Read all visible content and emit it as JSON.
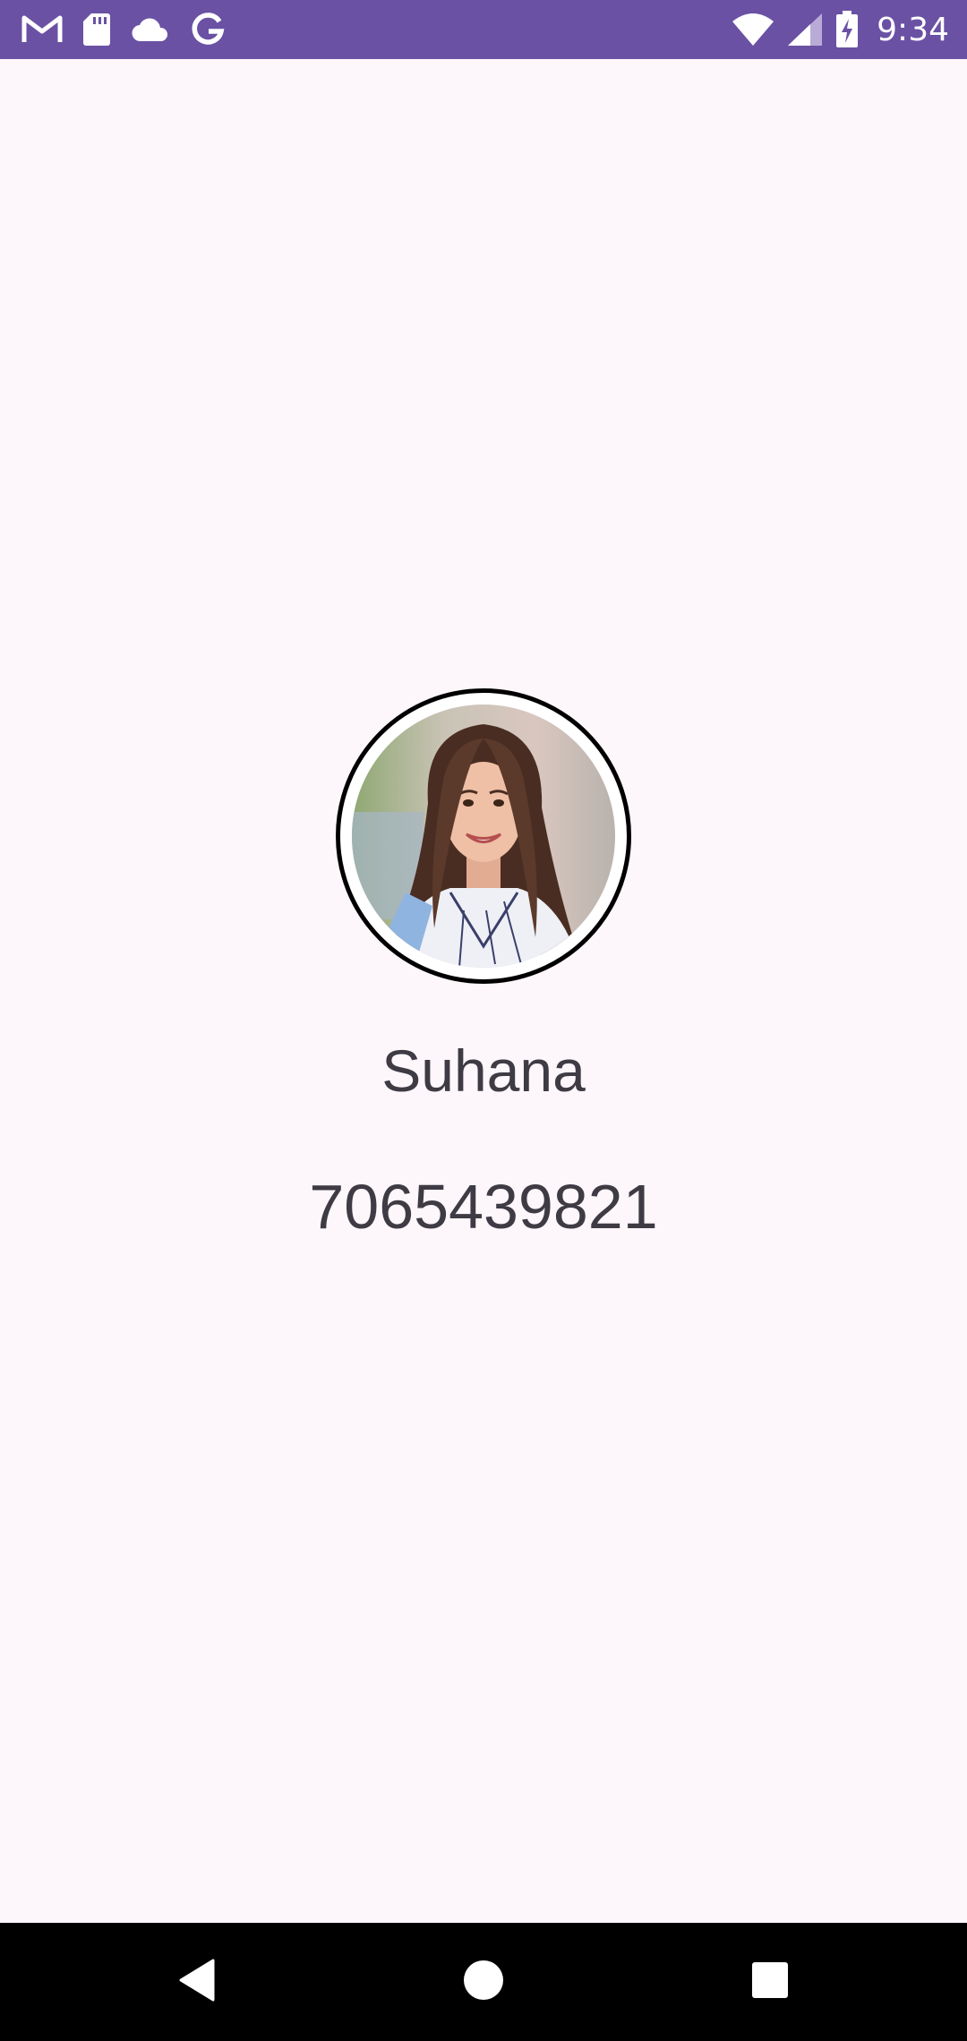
{
  "status_bar": {
    "time": "9:34",
    "left_icons": [
      "gmail-icon",
      "sd-card-icon",
      "cloud-icon",
      "google-icon"
    ],
    "right_icons": [
      "wifi-icon",
      "cell-signal-icon",
      "battery-charging-icon"
    ],
    "background_color": "#6a51a4"
  },
  "contact": {
    "name": "Suhana",
    "phone": "7065439821",
    "avatar": "profile-photo"
  },
  "nav_bar": {
    "buttons": [
      "back-icon",
      "home-icon",
      "recents-icon"
    ]
  }
}
